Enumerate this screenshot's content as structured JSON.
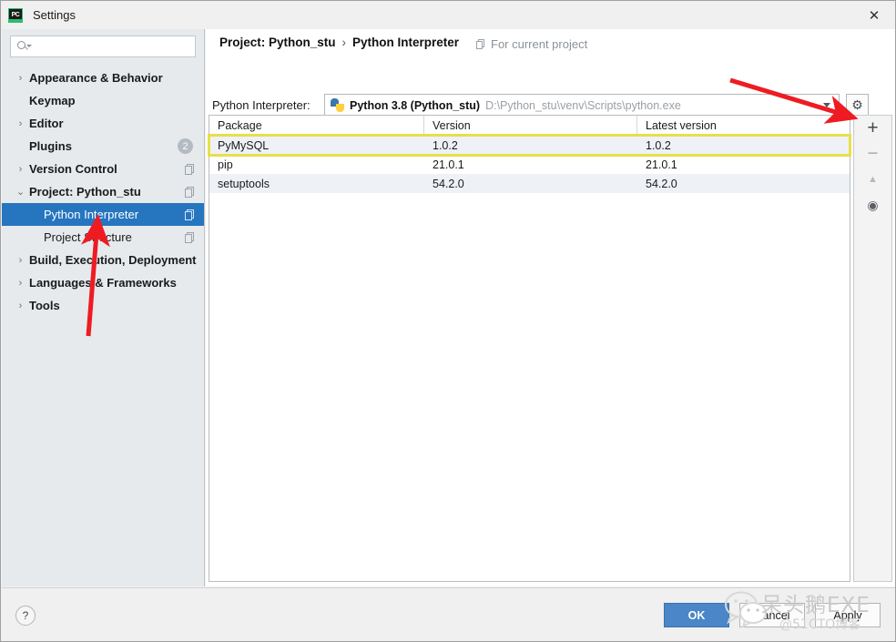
{
  "window": {
    "title": "Settings",
    "logo_text": "PC",
    "close_icon": "close-icon"
  },
  "sidebar": {
    "search": {
      "placeholder": "",
      "value": "",
      "icon": "search-icon"
    },
    "items": [
      {
        "label": "Appearance & Behavior",
        "arrow": "›",
        "bold": true,
        "child": false,
        "selected": false,
        "badge": "",
        "copy_icon": false
      },
      {
        "label": "Keymap",
        "arrow": "",
        "bold": true,
        "child": false,
        "selected": false,
        "badge": "",
        "copy_icon": false
      },
      {
        "label": "Editor",
        "arrow": "›",
        "bold": true,
        "child": false,
        "selected": false,
        "badge": "",
        "copy_icon": false
      },
      {
        "label": "Plugins",
        "arrow": "",
        "bold": true,
        "child": false,
        "selected": false,
        "badge": "2",
        "copy_icon": false
      },
      {
        "label": "Version Control",
        "arrow": "›",
        "bold": true,
        "child": false,
        "selected": false,
        "badge": "",
        "copy_icon": true
      },
      {
        "label": "Project: Python_stu",
        "arrow": "⌄",
        "bold": true,
        "child": false,
        "selected": false,
        "badge": "",
        "copy_icon": true
      },
      {
        "label": "Python Interpreter",
        "arrow": "",
        "bold": false,
        "child": true,
        "selected": true,
        "badge": "",
        "copy_icon": true
      },
      {
        "label": "Project Structure",
        "arrow": "",
        "bold": false,
        "child": true,
        "selected": false,
        "badge": "",
        "copy_icon": true
      },
      {
        "label": "Build, Execution, Deployment",
        "arrow": "›",
        "bold": true,
        "child": false,
        "selected": false,
        "badge": "",
        "copy_icon": false
      },
      {
        "label": "Languages & Frameworks",
        "arrow": "›",
        "bold": true,
        "child": false,
        "selected": false,
        "badge": "",
        "copy_icon": false
      },
      {
        "label": "Tools",
        "arrow": "›",
        "bold": true,
        "child": false,
        "selected": false,
        "badge": "",
        "copy_icon": false
      }
    ]
  },
  "main": {
    "breadcrumb_root": "Project: Python_stu",
    "breadcrumb_sep": "›",
    "breadcrumb_leaf": "Python Interpreter",
    "for_current_project": "For current project",
    "interpreter_label": "Python Interpreter:",
    "interpreter_name": "Python 3.8 (Python_stu)",
    "interpreter_path": "D:\\Python_stu\\venv\\Scripts\\python.exe",
    "gear_icon": "⚙",
    "table": {
      "columns": [
        "Package",
        "Version",
        "Latest version"
      ],
      "rows": [
        {
          "package": "PyMySQL",
          "version": "1.0.2",
          "latest": "1.0.2",
          "highlighted": true
        },
        {
          "package": "pip",
          "version": "21.0.1",
          "latest": "21.0.1",
          "highlighted": false
        },
        {
          "package": "setuptools",
          "version": "54.2.0",
          "latest": "54.2.0",
          "highlighted": false
        }
      ],
      "highlight_color": "#e8df4a"
    },
    "toolbar": {
      "add": "+",
      "remove": "−",
      "upgrade": "▲",
      "show_early": "◉"
    }
  },
  "bottom": {
    "help": "?",
    "ok": "OK",
    "cancel": "Cancel",
    "apply": "Apply"
  },
  "watermark": {
    "text": "呆头鹅EXE",
    "subtext": "@51CTO博客"
  },
  "colors": {
    "selection_blue": "#2675bf",
    "ok_button": "#4a86c8",
    "arrow_red": "#ee1c22",
    "highlight_yellow": "#e8df4a"
  }
}
